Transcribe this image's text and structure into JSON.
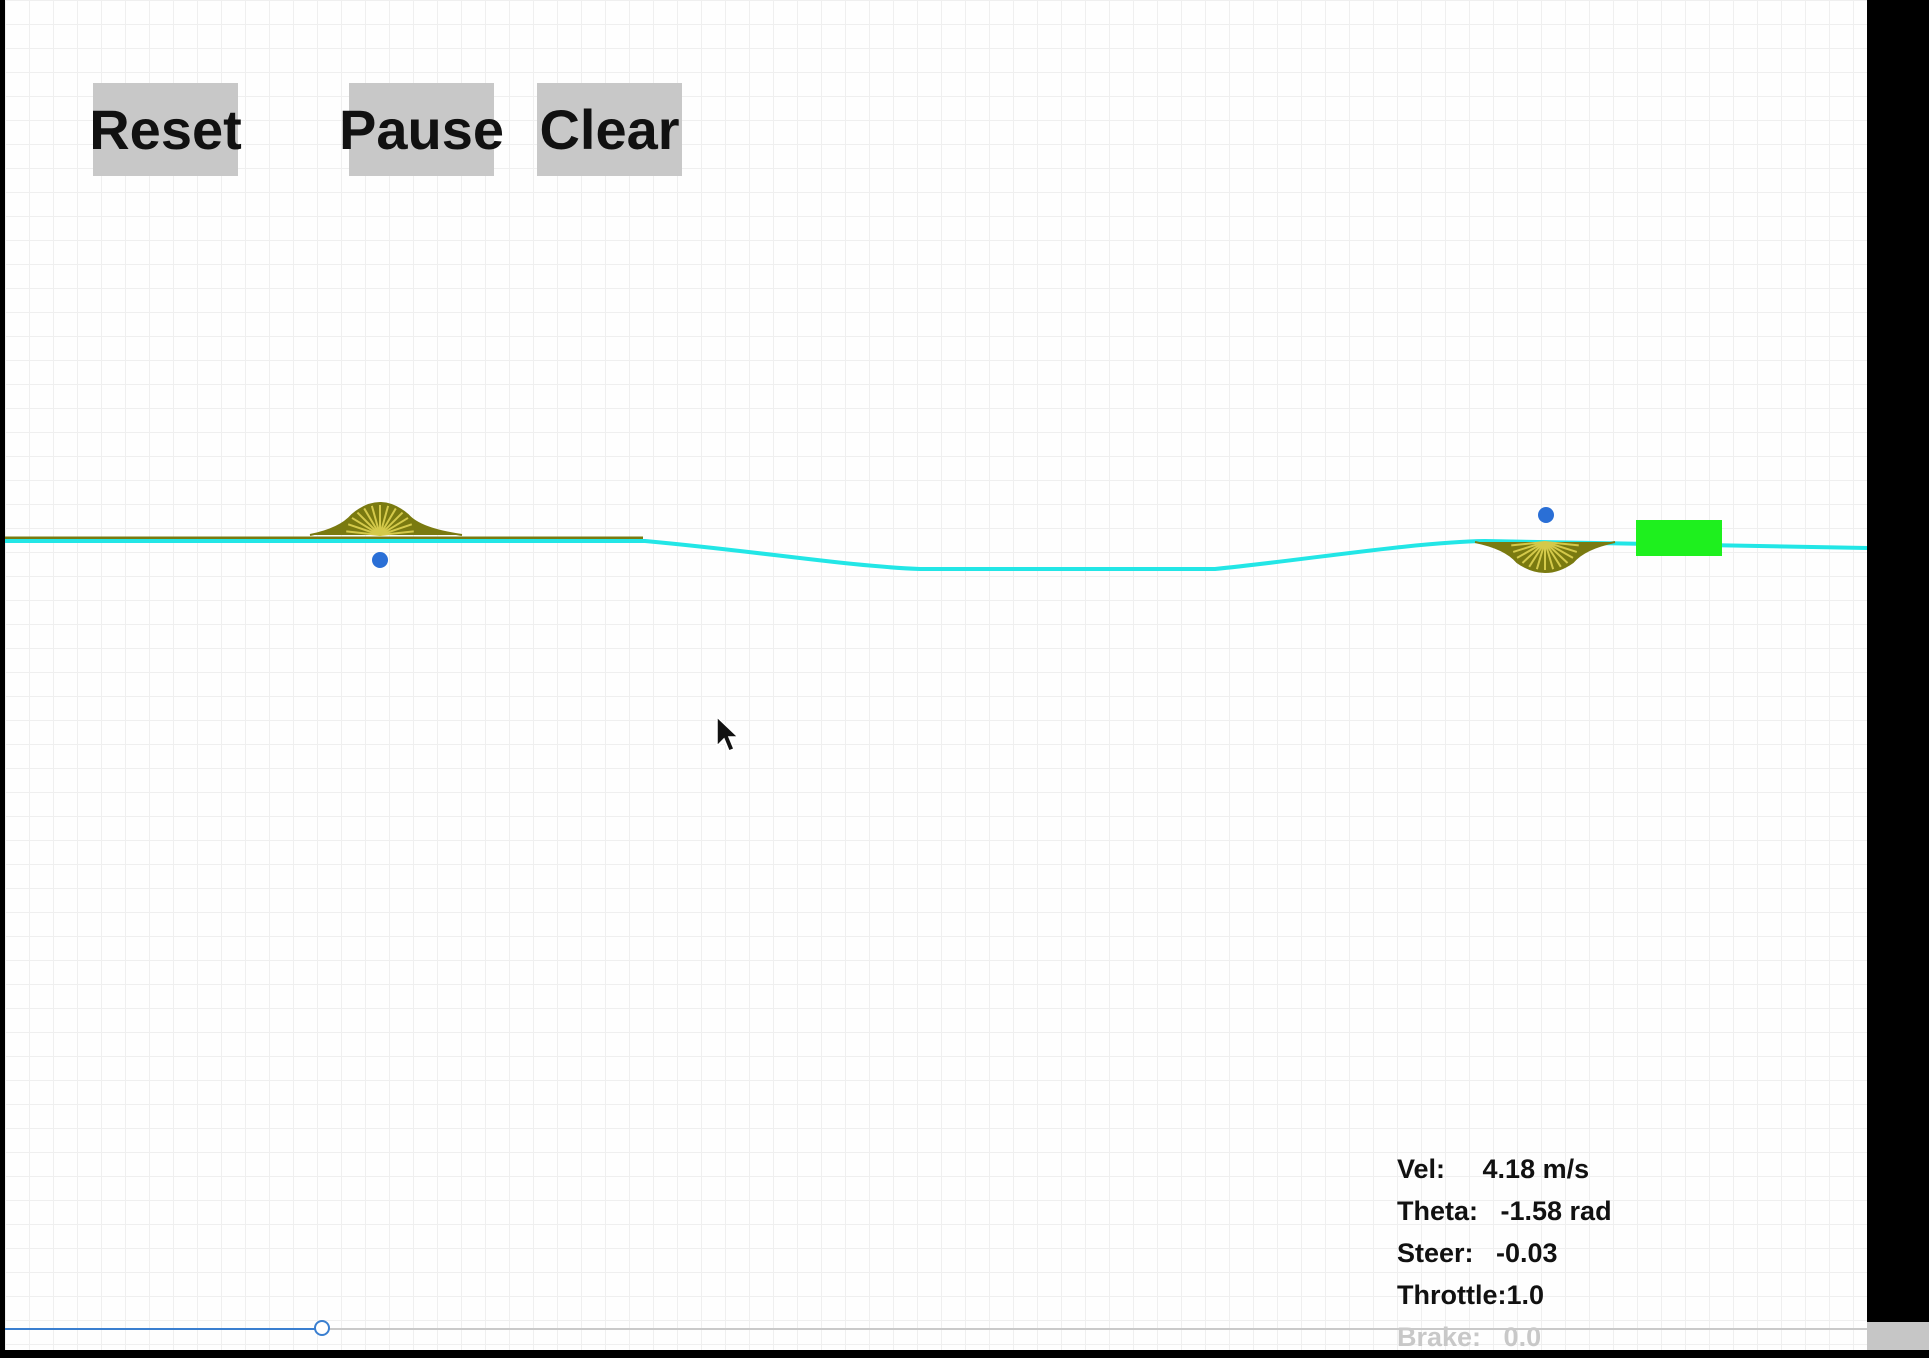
{
  "toolbar": {
    "reset_label": "Reset",
    "pause_label": "Pause",
    "clear_label": "Clear"
  },
  "readouts": {
    "vel": "Vel:     4.18 m/s",
    "theta": "Theta:   -1.58 rad",
    "steer": "Steer:   -0.03",
    "throttle": "Throttle:1.0",
    "brake": "Brake:   0.0"
  },
  "slider": {
    "value_fraction": 0.17
  },
  "colors": {
    "track": "#22e6e6",
    "ground": "#7a7a10",
    "sensor": "#d4c94a",
    "marker": "#2a6fd6",
    "vehicle": "#1ef01e",
    "button_bg": "#c8c8c8"
  },
  "icons": {
    "cursor": "arrow-cursor-icon"
  }
}
